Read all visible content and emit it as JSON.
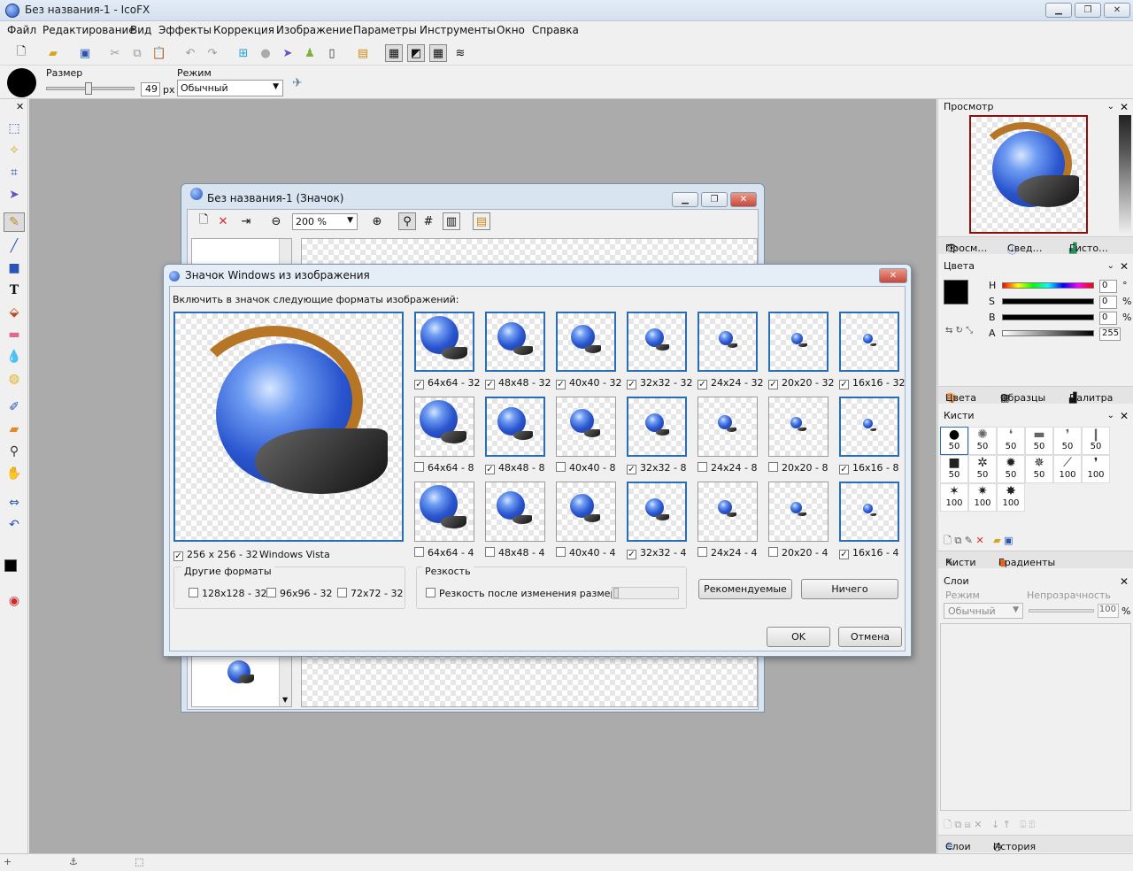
{
  "window": {
    "title": "Без названия-1 - IcoFX"
  },
  "menu": [
    "Файл",
    "Редактирование",
    "Вид",
    "Эффекты",
    "Коррекция",
    "Изображение",
    "Параметры",
    "Инструменты",
    "Окно",
    "Справка"
  ],
  "toolbar2": {
    "size_label": "Размер",
    "size_value": "49",
    "size_unit": "px",
    "size_fraction": 0.48,
    "mode_label": "Режим",
    "mode_value": "Обычный"
  },
  "icon_window": {
    "title": "Без названия-1 (Значок)",
    "zoom": "200 %"
  },
  "dialog": {
    "title": "Значок Windows из изображения",
    "intro": "Включить в значок следующие форматы изображений:",
    "main_label": "256 x 256 - 32",
    "main_os": "Windows Vista",
    "main_checked": true,
    "formats": [
      [
        {
          "label": "64x64 - 32",
          "checked": true,
          "sel": true
        },
        {
          "label": "48x48 - 32",
          "checked": true,
          "sel": true
        },
        {
          "label": "40x40 - 32",
          "checked": true,
          "sel": true
        },
        {
          "label": "32x32 - 32",
          "checked": true,
          "sel": true
        },
        {
          "label": "24x24 - 32",
          "checked": true,
          "sel": true
        },
        {
          "label": "20x20 - 32",
          "checked": true,
          "sel": true
        },
        {
          "label": "16x16 - 32",
          "checked": true,
          "sel": true
        }
      ],
      [
        {
          "label": "64x64 - 8",
          "checked": false,
          "sel": false
        },
        {
          "label": "48x48 - 8",
          "checked": true,
          "sel": true
        },
        {
          "label": "40x40 - 8",
          "checked": false,
          "sel": false
        },
        {
          "label": "32x32 - 8",
          "checked": true,
          "sel": true
        },
        {
          "label": "24x24 - 8",
          "checked": false,
          "sel": false
        },
        {
          "label": "20x20 - 8",
          "checked": false,
          "sel": false
        },
        {
          "label": "16x16 - 8",
          "checked": true,
          "sel": true
        }
      ],
      [
        {
          "label": "64x64 - 4",
          "checked": false,
          "sel": false
        },
        {
          "label": "48x48 - 4",
          "checked": false,
          "sel": false
        },
        {
          "label": "40x40 - 4",
          "checked": false,
          "sel": false
        },
        {
          "label": "32x32 - 4",
          "checked": true,
          "sel": true
        },
        {
          "label": "24x24 - 4",
          "checked": false,
          "sel": false
        },
        {
          "label": "20x20 - 4",
          "checked": false,
          "sel": false
        },
        {
          "label": "16x16 - 4",
          "checked": true,
          "sel": true
        }
      ]
    ],
    "other_title": "Другие форматы",
    "other": [
      "128x128 - 32",
      "96x96 - 32",
      "72x72 - 32"
    ],
    "sharp_title": "Резкость",
    "sharp_label": "Резкость после изменения размера",
    "btn_recommended": "Рекомендуемые",
    "btn_none": "Ничего",
    "btn_ok": "OK",
    "btn_cancel": "Отмена"
  },
  "preview": {
    "title": "Просмотр",
    "tabs": [
      "Просм…",
      "Свед…",
      "Гисто…"
    ]
  },
  "colors": {
    "title": "Цвета",
    "channels": [
      {
        "name": "H",
        "value": "0",
        "unit": "°"
      },
      {
        "name": "S",
        "value": "0",
        "unit": "%"
      },
      {
        "name": "B",
        "value": "0",
        "unit": "%"
      },
      {
        "name": "A",
        "value": "255",
        "unit": ""
      }
    ],
    "tabs": [
      "Цвета",
      "Образцы",
      "Палитра"
    ]
  },
  "brushes": {
    "title": "Кисти",
    "sizes": [
      "50",
      "50",
      "50",
      "50",
      "50",
      "50",
      "50",
      "50",
      "50",
      "50",
      "100",
      "100",
      "100",
      "100",
      "100"
    ],
    "tabs": [
      "Кисти",
      "Градиенты"
    ]
  },
  "layers": {
    "title": "Слои",
    "mode_label": "Режим",
    "mode_value": "Обычный",
    "opacity_label": "Непрозрачность",
    "opacity_value": "100",
    "opacity_unit": "%",
    "tabs": [
      "Слои",
      "История"
    ]
  }
}
